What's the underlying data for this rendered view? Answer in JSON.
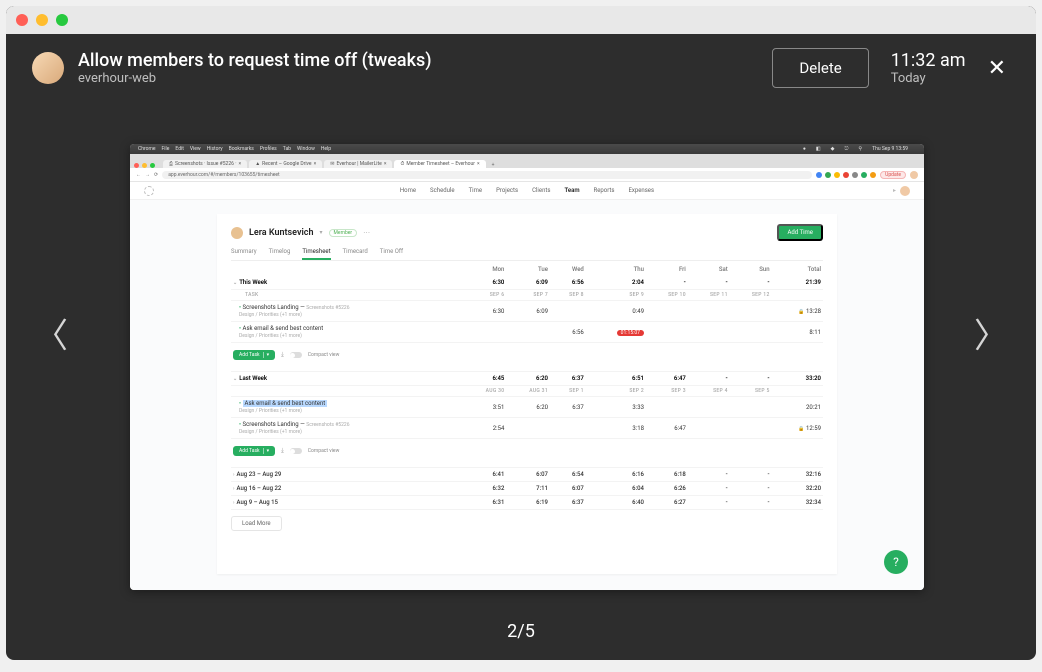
{
  "header": {
    "title": "Allow members to request time off (tweaks)",
    "subtitle": "everhour-web",
    "delete_label": "Delete",
    "time": "11:32 am",
    "time_sub": "Today"
  },
  "counter": "2/5",
  "mac_menubar": {
    "app": "Chrome",
    "items": [
      "File",
      "Edit",
      "View",
      "History",
      "Bookmarks",
      "Profiles",
      "Tab",
      "Window",
      "Help"
    ],
    "clock": "Thu Sep 9  13:59"
  },
  "browser": {
    "tabs": [
      {
        "label": "Screenshots · Issue #5226 ·"
      },
      {
        "label": "Recent – Google Drive"
      },
      {
        "label": "Everhour | MailerLite"
      },
      {
        "label": "Member Timesheet – Everhour",
        "active": true
      }
    ],
    "url": "app.everhour.com/#/members/103655/timesheet",
    "update": "Update"
  },
  "app_nav": {
    "items": [
      "Home",
      "Schedule",
      "Time",
      "Projects",
      "Clients",
      "Team",
      "Reports",
      "Expenses"
    ],
    "active": "Team"
  },
  "user": {
    "name": "Lera Kuntsevich",
    "badge": "Member",
    "add_time": "Add Time"
  },
  "subtabs": {
    "items": [
      "Summary",
      "Timelog",
      "Timesheet",
      "Timecard",
      "Time Off"
    ],
    "active": "Timesheet"
  },
  "days": [
    "Mon",
    "Tue",
    "Wed",
    "Thu",
    "Fri",
    "Sat",
    "Sun",
    "Total"
  ],
  "this_week": {
    "label": "This Week",
    "values": [
      "6:30",
      "6:09",
      "6:56",
      "2:04",
      "-",
      "-",
      "-",
      "21:39"
    ],
    "dates_label": "TASK",
    "dates": [
      "SEP 6",
      "SEP 7",
      "SEP 8",
      "SEP 9",
      "SEP 10",
      "SEP 11",
      "SEP 12",
      ""
    ],
    "rows": [
      {
        "title": "Screenshots Landing",
        "link": "Screenshots #5226",
        "meta": "Design / Priorities  (+1 more)",
        "values": [
          "6:30",
          "6:09",
          "",
          "0:49",
          "",
          "",
          "",
          "13:28"
        ],
        "lock": true
      },
      {
        "title": "Ask email & send best content",
        "meta": "Design / Priorities  (+1 more)",
        "values": [
          "",
          "",
          "6:56",
          "",
          "",
          "",
          "",
          "8:11"
        ],
        "pill": "01:15:07"
      }
    ],
    "add_task": "Add Task",
    "compact": "Compact view"
  },
  "last_week": {
    "label": "Last Week",
    "values": [
      "6:45",
      "6:20",
      "6:37",
      "6:51",
      "6:47",
      "-",
      "-",
      "33:20"
    ],
    "dates": [
      "AUG 30",
      "AUG 31",
      "SEP 1",
      "SEP 2",
      "SEP 3",
      "SEP 4",
      "SEP 5",
      ""
    ],
    "rows": [
      {
        "title": "Ask email & send best content",
        "hl": true,
        "meta": "Design / Priorities  (+1 more)",
        "values": [
          "3:51",
          "6:20",
          "6:37",
          "3:33",
          "",
          "",
          "",
          "20:21"
        ]
      },
      {
        "title": "Screenshots Landing",
        "link": "Screenshots #5226",
        "meta": "Design / Priorities  (+1 more)",
        "values": [
          "2:54",
          "",
          "",
          "3:18",
          "6:47",
          "",
          "",
          "12:59"
        ],
        "lock": true
      }
    ],
    "add_task": "Add Task",
    "compact": "Compact view"
  },
  "collapsed": [
    {
      "label": "Aug 23 – Aug 29",
      "values": [
        "6:41",
        "6:07",
        "6:54",
        "6:16",
        "6:18",
        "-",
        "-",
        "32:16"
      ]
    },
    {
      "label": "Aug 16 – Aug 22",
      "values": [
        "6:32",
        "7:11",
        "6:07",
        "6:04",
        "6:26",
        "-",
        "-",
        "32:20"
      ]
    },
    {
      "label": "Aug 9 – Aug 15",
      "values": [
        "6:31",
        "6:19",
        "6:37",
        "6:40",
        "6:27",
        "-",
        "-",
        "32:34"
      ]
    }
  ],
  "load_more": "Load More",
  "help": "?"
}
